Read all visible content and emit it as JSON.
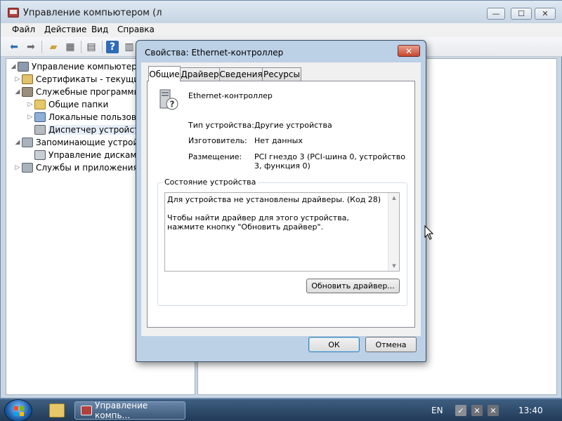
{
  "main_window": {
    "title": "Управление компьютером (л",
    "controls": {
      "minimize": "—",
      "maximize": "☐",
      "close": "✕"
    }
  },
  "menu": [
    "Файл",
    "Действие",
    "Вид",
    "Справка"
  ],
  "toolbar_icons": [
    "back-icon",
    "forward-icon",
    "up-folder-icon",
    "console-tree-icon",
    "export-icon",
    "help-icon",
    "properties-icon"
  ],
  "tree": [
    {
      "label": "Управление компьютером (л",
      "icon": "computer-management-icon"
    },
    {
      "label": "Сертификаты - текущий п",
      "icon": "certificates-icon"
    },
    {
      "label": "Служебные программы",
      "icon": "tools-icon"
    },
    {
      "label": "Общие папки",
      "icon": "shared-folders-icon"
    },
    {
      "label": "Локальные пользовате",
      "icon": "local-users-icon"
    },
    {
      "label": "Диспетчер устройств",
      "icon": "device-manager-icon"
    },
    {
      "label": "Запоминающие устройст",
      "icon": "storage-icon"
    },
    {
      "label": "Управление дисками",
      "icon": "disk-management-icon"
    },
    {
      "label": "Службы и приложения",
      "icon": "services-icon"
    }
  ],
  "dialog": {
    "title": "Свойства: Ethernet-контроллер",
    "close": "✕",
    "tabs": [
      "Общие",
      "Драйвер",
      "Сведения",
      "Ресурсы"
    ],
    "active_tab": "Общие",
    "device_name": "Ethernet-контроллер",
    "props": {
      "type_label": "Тип устройства:",
      "type_value": "Другие устройства",
      "manufacturer_label": "Изготовитель:",
      "manufacturer_value": "Нет данных",
      "location_label": "Размещение:",
      "location_value": "PCI гнездо 3 (PCI-шина 0, устройство 3, функция 0)"
    },
    "status_group": "Состояние устройства",
    "status_text": "Для устройства не установлены драйверы. (Код 28)\n\nЧтобы найти драйвер для этого устройства, нажмите кнопку \"Обновить драйвер\".",
    "update_driver_button": "Обновить драйвер...",
    "ok_button": "ОК",
    "cancel_button": "Отмена"
  },
  "taskbar": {
    "task_title": "Управление компь...",
    "language": "EN",
    "time": "13:40"
  }
}
